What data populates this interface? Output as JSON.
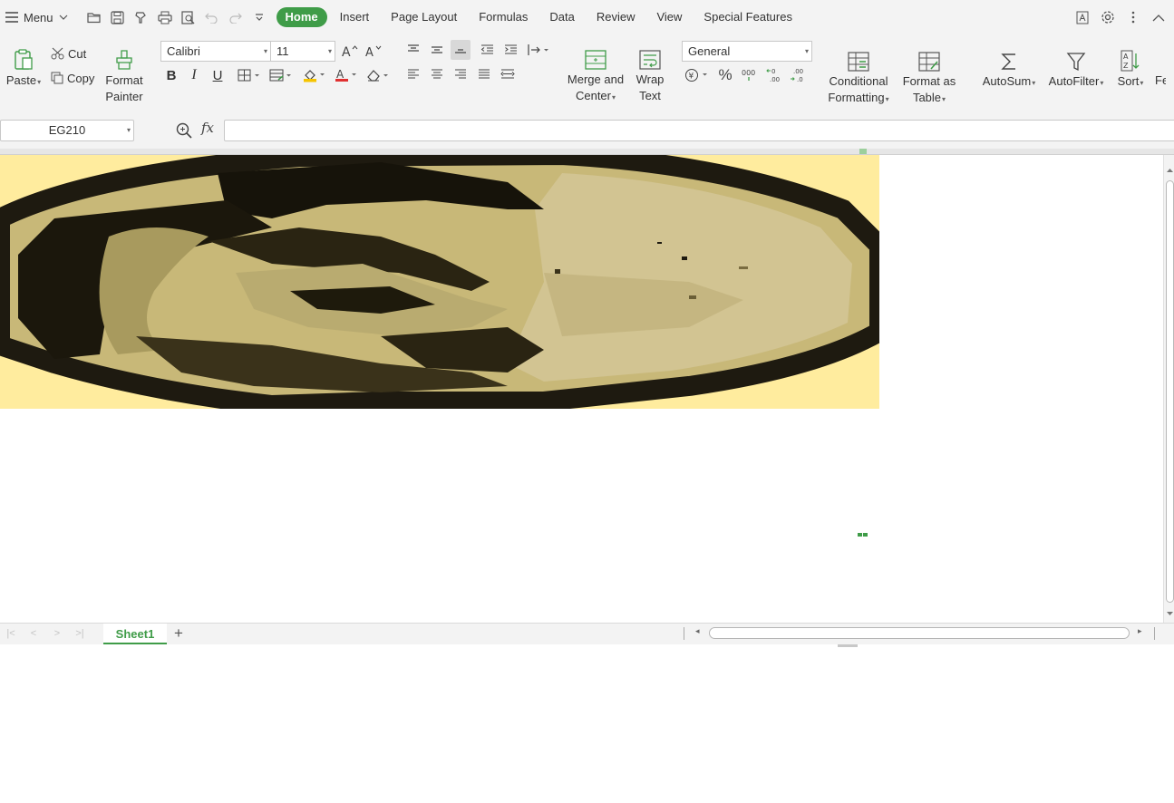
{
  "menubar": {
    "menu_label": "Menu",
    "tabs": [
      {
        "label": "Home",
        "active": true
      },
      {
        "label": "Insert"
      },
      {
        "label": "Page Layout"
      },
      {
        "label": "Formulas"
      },
      {
        "label": "Data"
      },
      {
        "label": "Review"
      },
      {
        "label": "View"
      },
      {
        "label": "Special Features"
      }
    ],
    "quick_icons": [
      "open-folder-icon",
      "save-icon",
      "format-icon",
      "print-icon",
      "print-preview-icon",
      "undo-icon",
      "redo-icon",
      "customize-icon"
    ]
  },
  "ribbon": {
    "paste": "Paste",
    "cut": "Cut",
    "copy": "Copy",
    "format_painter_l1": "Format",
    "format_painter_l2": "Painter",
    "font_name": "Calibri",
    "font_size": "11",
    "merge_l1": "Merge and",
    "merge_l2": "Center",
    "wrap_l1": "Wrap",
    "wrap_l2": "Text",
    "number_format": "General",
    "cond_l1": "Conditional",
    "cond_l2": "Formatting",
    "fat_l1": "Format as",
    "fat_l2": "Table",
    "autosum": "AutoSum",
    "autofilter": "AutoFilter",
    "sort": "Sort",
    "fe": "Fe",
    "font_color": "#e03030",
    "fill_color": "#f5c400"
  },
  "formula_bar": {
    "name_box": "EG210",
    "fx": "fx",
    "formula": ""
  },
  "sheet": {
    "picture_background": "#ffec9e",
    "tabs": [
      "Sheet1"
    ],
    "accent": "#3f9c48"
  }
}
